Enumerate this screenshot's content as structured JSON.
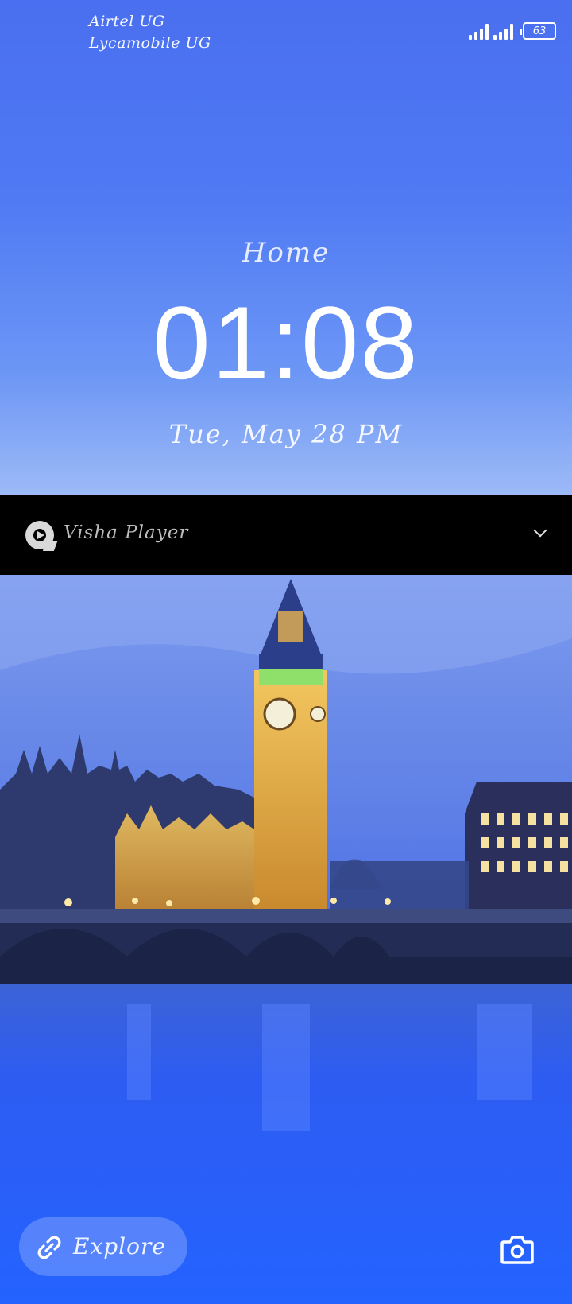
{
  "status_bar": {
    "carrier_1": "Airtel UG",
    "carrier_2": "Lycamobile UG",
    "battery_level": "63",
    "icons": [
      "signal-icon",
      "signal-icon",
      "battery-icon"
    ]
  },
  "lockscreen": {
    "location": "Home",
    "time": "01:08",
    "date": "Tue, May 28 PM"
  },
  "notification": {
    "app_name": "Visha Player",
    "icon": "play-icon",
    "expand_icon": "chevron-down-icon"
  },
  "bottom": {
    "explore_label": "Explore",
    "explore_icon": "link-icon",
    "camera_icon": "camera-icon"
  },
  "colors": {
    "sky": "#4f79f5",
    "notification_bg": "#000000",
    "water": "#2660ff"
  }
}
